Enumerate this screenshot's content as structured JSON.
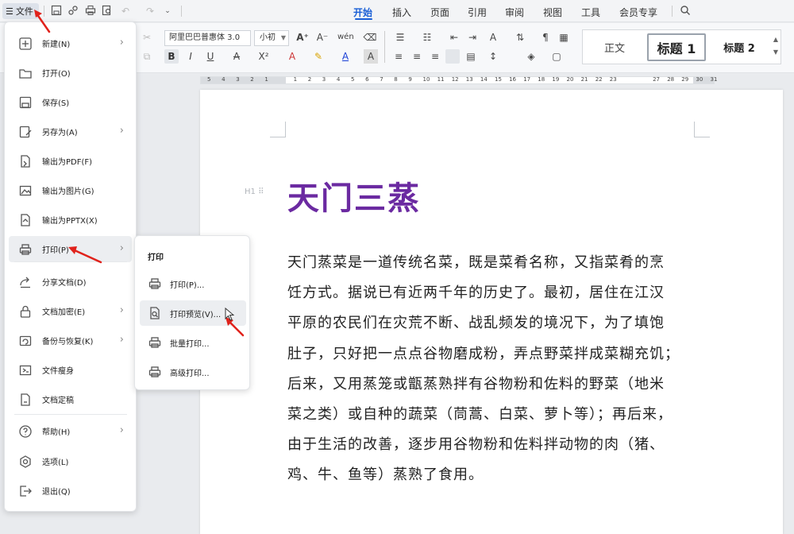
{
  "app": {
    "file_menu_button": "文件",
    "menu_glyph": "☰"
  },
  "tabs": [
    {
      "label": "开始",
      "active": true
    },
    {
      "label": "插入"
    },
    {
      "label": "页面"
    },
    {
      "label": "引用"
    },
    {
      "label": "审阅"
    },
    {
      "label": "视图"
    },
    {
      "label": "工具"
    },
    {
      "label": "会员专享"
    }
  ],
  "ribbon": {
    "font_name": "阿里巴巴普惠体 3.0",
    "font_size": "小初",
    "styles": {
      "normal": "正文",
      "heading1": "标题 1",
      "heading2": "标题 2"
    }
  },
  "ruler": {
    "numbers": [
      "5",
      "4",
      "3",
      "2",
      "1",
      "",
      "1",
      "2",
      "3",
      "4",
      "5",
      "6",
      "7",
      "8",
      "9",
      "10",
      "11",
      "12",
      "13",
      "14",
      "15",
      "16",
      "17",
      "18",
      "19",
      "20",
      "21",
      "22",
      "23",
      "",
      "",
      "27",
      "28",
      "29",
      "30",
      "31"
    ]
  },
  "document": {
    "title": "天门三蒸",
    "heading_marker": "H1",
    "paragraph_lines": [
      "天门蒸菜是一道传统名菜，既是菜肴名称，又指菜肴的烹",
      "饪方式。据说已有近两千年的历史了。最初，居住在江汉",
      "平原的农民们在灾荒不断、战乱频发的境况下，为了填饱",
      "肚子，只好把一点点谷物磨成粉，弄点野菜拌成菜糊充饥；",
      "后来，又用蒸笼或甑蒸熟拌有谷物粉和佐料的野菜（地米",
      "菜之类）或自种的蔬菜（茼蒿、白菜、萝卜等）；再后来，",
      "由于生活的改善，逐步用谷物粉和佐料拌动物的肉（猪、",
      "鸡、牛、鱼等）蒸熟了食用。"
    ]
  },
  "file_menu": {
    "items": [
      {
        "label": "新建(N)",
        "icon": "plus-icon",
        "has_submenu": true
      },
      {
        "label": "打开(O)",
        "icon": "folder-icon"
      },
      {
        "label": "保存(S)",
        "icon": "save-icon"
      },
      {
        "label": "另存为(A)",
        "icon": "save-as-icon",
        "has_submenu": true
      },
      {
        "label": "输出为PDF(F)",
        "icon": "pdf-icon"
      },
      {
        "label": "输出为图片(G)",
        "icon": "image-icon"
      },
      {
        "label": "输出为PPTX(X)",
        "icon": "pptx-icon"
      },
      {
        "label": "打印(P)",
        "icon": "printer-icon",
        "has_submenu": true,
        "highlighted": true
      },
      {
        "label": "分享文档(D)",
        "icon": "share-icon"
      },
      {
        "label": "文档加密(E)",
        "icon": "lock-icon",
        "has_submenu": true
      },
      {
        "label": "备份与恢复(K)",
        "icon": "backup-icon",
        "has_submenu": true
      },
      {
        "label": "文件瘦身",
        "icon": "slim-icon"
      },
      {
        "label": "文档定稿",
        "icon": "finalize-icon"
      },
      {
        "label": "帮助(H)",
        "icon": "help-icon",
        "has_submenu": true
      },
      {
        "label": "选项(L)",
        "icon": "settings-icon"
      },
      {
        "label": "退出(Q)",
        "icon": "exit-icon"
      }
    ]
  },
  "print_menu": {
    "title": "打印",
    "items": [
      {
        "label": "打印(P)...",
        "icon": "printer-icon"
      },
      {
        "label": "打印预览(V)...",
        "icon": "print-preview-icon",
        "highlighted": true
      },
      {
        "label": "批量打印...",
        "icon": "batch-print-icon"
      },
      {
        "label": "高级打印...",
        "icon": "advanced-print-icon"
      }
    ]
  },
  "colors": {
    "accent": "#1a5fd6",
    "title": "#6b2aa1",
    "annotation": "#e0221b"
  }
}
